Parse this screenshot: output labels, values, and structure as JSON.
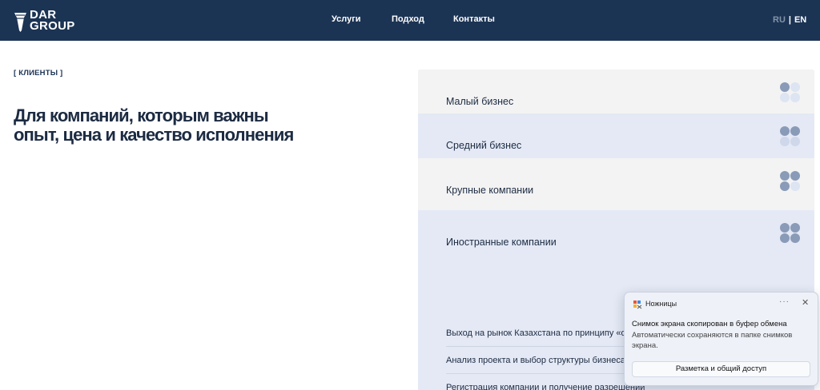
{
  "header": {
    "logo_line1": "DAR",
    "logo_line2": "GROUP",
    "nav": [
      "Услуги",
      "Подход",
      "Контакты"
    ],
    "lang_ru": "RU",
    "lang_sep": "|",
    "lang_en": "EN"
  },
  "section": {
    "tag": "[ КЛИЕНТЫ ]",
    "heading_line1": "Для компаний, которым важны",
    "heading_line2": "опыт, цена и качество исполнения"
  },
  "clients": {
    "items": [
      {
        "label": "Малый бизнес",
        "filled_dots": 1
      },
      {
        "label": "Средний бизнес",
        "filled_dots": 2
      },
      {
        "label": "Крупные компании",
        "filled_dots": 3
      },
      {
        "label": "Иностранные компании",
        "filled_dots": 4
      }
    ],
    "foreign_services": [
      "Выход на рынок Казахстана по принципу «о",
      "Анализ проекта и выбор структуры бизнеса",
      "Регистрация компании и получение разрешений"
    ]
  },
  "toast": {
    "app_name": "Ножницы",
    "more": "···",
    "close": "✕",
    "title": "Снимок экрана скопирован в буфер обмена",
    "body": "Автоматически сохраняются в папке снимков экрана.",
    "button": "Разметка и общий доступ"
  },
  "colors": {
    "header_bg": "#1c3454",
    "accent_blue_light": "#e4e9f5",
    "row_grey": "#f3f3f3",
    "dot_active": "#8a9bb8"
  }
}
